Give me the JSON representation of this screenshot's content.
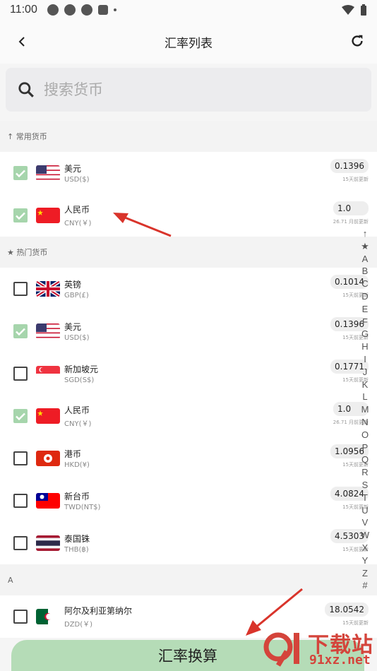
{
  "status": {
    "time": "11:00"
  },
  "header": {
    "title": "汇率列表"
  },
  "search": {
    "placeholder": "搜索货币"
  },
  "sections": {
    "common": "↑ 常用货币",
    "hot": "★ 热门货币",
    "a": "A"
  },
  "common_items": [
    {
      "name": "美元",
      "code": "USD($)",
      "rate": "0.1396",
      "updated": "15天前更新",
      "checked": true,
      "flag": "us"
    },
    {
      "name": "人民币",
      "code": "CNY(￥)",
      "rate": "1.0",
      "updated": "26.71 月前更新",
      "checked": true,
      "flag": "cn"
    }
  ],
  "hot_items": [
    {
      "name": "英镑",
      "code": "GBP(£)",
      "rate": "0.1014",
      "updated": "15天前更新",
      "checked": false,
      "flag": "gb"
    },
    {
      "name": "美元",
      "code": "USD($)",
      "rate": "0.1396",
      "updated": "15天前更新",
      "checked": true,
      "flag": "us"
    },
    {
      "name": "新加坡元",
      "code": "SGD(S$)",
      "rate": "0.1771",
      "updated": "15天前更新",
      "checked": false,
      "flag": "sg"
    },
    {
      "name": "人民币",
      "code": "CNY(￥)",
      "rate": "1.0",
      "updated": "26.71 月前更新",
      "checked": true,
      "flag": "cn"
    },
    {
      "name": "港币",
      "code": "HKD(¥)",
      "rate": "1.0956",
      "updated": "15天前更新",
      "checked": false,
      "flag": "hk"
    },
    {
      "name": "新台币",
      "code": "TWD(NT$)",
      "rate": "4.0824",
      "updated": "15天前更新",
      "checked": false,
      "flag": "tw"
    },
    {
      "name": "泰国铢",
      "code": "THB(฿)",
      "rate": "4.5303",
      "updated": "15天前更新",
      "checked": false,
      "flag": "th"
    }
  ],
  "a_items": [
    {
      "name": "阿尔及利亚第纳尔",
      "code": "DZD(￥)",
      "rate": "18.0542",
      "updated": "15天前更新",
      "checked": false,
      "flag": "dz"
    }
  ],
  "alpha_index": [
    "↑",
    "★",
    "A",
    "B",
    "C",
    "D",
    "E",
    "F",
    "G",
    "H",
    "I",
    "J",
    "K",
    "L",
    "M",
    "N",
    "O",
    "P",
    "Q",
    "R",
    "S",
    "T",
    "U",
    "V",
    "W",
    "X",
    "Y",
    "Z",
    "#"
  ],
  "convert_button": "汇率换算",
  "watermark": {
    "brand": "下载站",
    "site": "91xz.net"
  },
  "colors": {
    "accent_green": "#b5dcb7",
    "check_green": "#a6d5ac",
    "arrow_red": "#d9342b"
  }
}
